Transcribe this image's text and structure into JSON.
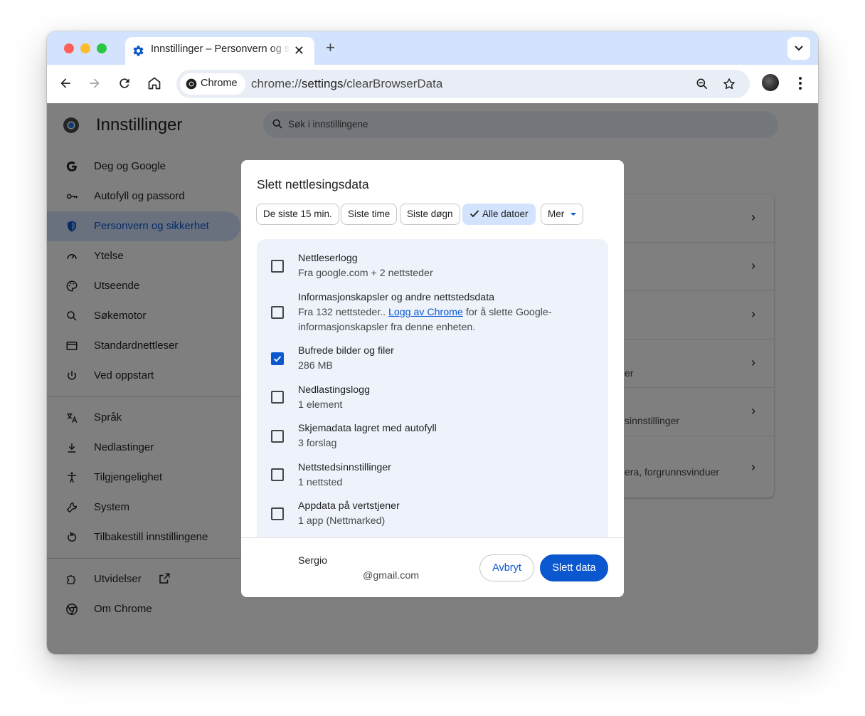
{
  "browser": {
    "tab_title": "Innstillinger – Personvern og sikkerhet",
    "new_tab_label": "+",
    "chip_label": "Chrome",
    "url_prefix": "chrome://",
    "url_bold": "settings",
    "url_suffix": "/clearBrowserData"
  },
  "settings": {
    "title": "Innstillinger",
    "search_placeholder": "Søk i innstillingene",
    "nav": [
      {
        "label": "Deg og Google",
        "icon": "google-g-icon"
      },
      {
        "label": "Autofyll og passord",
        "icon": "key-icon"
      },
      {
        "label": "Personvern og sikkerhet",
        "icon": "shield-icon",
        "active": true
      },
      {
        "label": "Ytelse",
        "icon": "speedometer-icon"
      },
      {
        "label": "Utseende",
        "icon": "palette-icon"
      },
      {
        "label": "Søkemotor",
        "icon": "search-icon"
      },
      {
        "label": "Standardnettleser",
        "icon": "browser-window-icon"
      },
      {
        "label": "Ved oppstart",
        "icon": "power-icon"
      },
      {
        "label": "Språk",
        "icon": "translate-icon"
      },
      {
        "label": "Nedlastinger",
        "icon": "download-icon"
      },
      {
        "label": "Tilgjengelighet",
        "icon": "accessibility-icon"
      },
      {
        "label": "System",
        "icon": "wrench-icon"
      },
      {
        "label": "Tilbakestill innstillingene",
        "icon": "reset-icon"
      },
      {
        "label": "Utvidelser",
        "icon": "puzzle-icon"
      },
      {
        "label": "Om Chrome",
        "icon": "chrome-icon"
      }
    ],
    "bg_card_rows": [
      "",
      "",
      "",
      "er",
      "sinnstillinger",
      "era, forgrunnsvinduer"
    ]
  },
  "dialog": {
    "title": "Slett nettlesingsdata",
    "time_ranges": [
      "De siste 15 min.",
      "Siste time",
      "Siste døgn",
      "Alle datoer",
      "Mer"
    ],
    "selected_range": "Alle datoer",
    "items": [
      {
        "title": "Nettleserlogg",
        "subtitle": "Fra google.com + 2 nettsteder",
        "checked": false
      },
      {
        "title": "Informasjonskapsler og andre nettstedsdata",
        "subtitle_pre": "Fra 132 nettsteder.. ",
        "link": "Logg av Chrome",
        "subtitle_post": " for å slette Google-",
        "subtitle_line2": "informasjonskapsler fra denne enheten.",
        "checked": false
      },
      {
        "title": "Bufrede bilder og filer",
        "subtitle": "286 MB",
        "checked": true
      },
      {
        "title": "Nedlastingslogg",
        "subtitle": "1 element",
        "checked": false
      },
      {
        "title": "Skjemadata lagret med autofyll",
        "subtitle": "3 forslag",
        "checked": false
      },
      {
        "title": "Nettstedsinnstillinger",
        "subtitle": "1 nettsted",
        "checked": false
      },
      {
        "title": "Appdata på vertstjener",
        "subtitle": "1 app (Nettmarked)",
        "checked": false
      }
    ],
    "account_name": "Sergio",
    "account_email": "@gmail.com",
    "cancel_label": "Avbryt",
    "confirm_label": "Slett data"
  },
  "colors": {
    "accent": "#0b57d0",
    "tabstrip": "#d3e3fd",
    "omnibox": "#e9eef6"
  }
}
